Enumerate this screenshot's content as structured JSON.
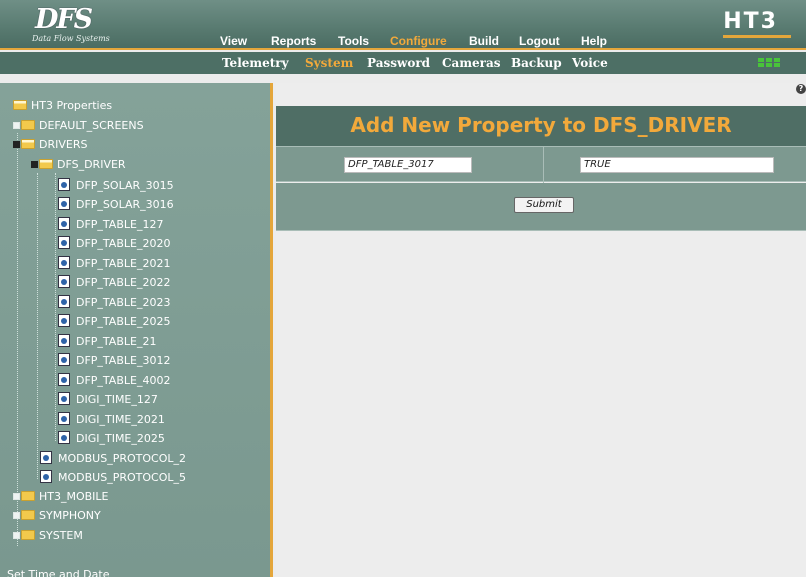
{
  "brand": {
    "logo_text": "DFS",
    "tagline": "Data Flow Systems",
    "product": "HT3"
  },
  "main_nav": [
    "View",
    "Reports",
    "Tools",
    "Configure",
    "Build",
    "Logout",
    "Help"
  ],
  "main_nav_active": "Configure",
  "sub_nav": [
    "Telemetry",
    "System",
    "Password",
    "Cameras",
    "Backup",
    "Voice"
  ],
  "sub_nav_active": "System",
  "tree": {
    "root": "HT3 Properties",
    "nodes": [
      {
        "label": "DEFAULT_SCREENS",
        "type": "folder",
        "state": "collapsed"
      },
      {
        "label": "DRIVERS",
        "type": "folder",
        "state": "expanded"
      },
      {
        "label": "DFS_DRIVER",
        "type": "folder",
        "state": "expanded"
      },
      {
        "label": "DFP_SOLAR_3015",
        "type": "item"
      },
      {
        "label": "DFP_SOLAR_3016",
        "type": "item"
      },
      {
        "label": "DFP_TABLE_127",
        "type": "item"
      },
      {
        "label": "DFP_TABLE_2020",
        "type": "item"
      },
      {
        "label": "DFP_TABLE_2021",
        "type": "item"
      },
      {
        "label": "DFP_TABLE_2022",
        "type": "item"
      },
      {
        "label": "DFP_TABLE_2023",
        "type": "item"
      },
      {
        "label": "DFP_TABLE_2025",
        "type": "item"
      },
      {
        "label": "DFP_TABLE_21",
        "type": "item"
      },
      {
        "label": "DFP_TABLE_3012",
        "type": "item"
      },
      {
        "label": "DFP_TABLE_4002",
        "type": "item"
      },
      {
        "label": "DIGI_TIME_127",
        "type": "item"
      },
      {
        "label": "DIGI_TIME_2021",
        "type": "item"
      },
      {
        "label": "DIGI_TIME_2025",
        "type": "item"
      },
      {
        "label": "MODBUS_PROTOCOL_2",
        "type": "item"
      },
      {
        "label": "MODBUS_PROTOCOL_5",
        "type": "item"
      },
      {
        "label": "HT3_MOBILE",
        "type": "folder",
        "state": "collapsed"
      },
      {
        "label": "SYMPHONY",
        "type": "folder",
        "state": "collapsed"
      },
      {
        "label": "SYSTEM",
        "type": "folder",
        "state": "collapsed"
      }
    ],
    "footer_link": "Set Time and Date"
  },
  "main": {
    "help_icon": "?",
    "title": "Add New Property to DFS_DRIVER",
    "property_name": "DFP_TABLE_3017",
    "property_value": "TRUE",
    "submit_label": "Submit"
  },
  "colors": {
    "accent": "#f2a93b",
    "panel": "#4f6e65",
    "tree_bg": "#7a988f",
    "status_light": "#49c43a"
  }
}
